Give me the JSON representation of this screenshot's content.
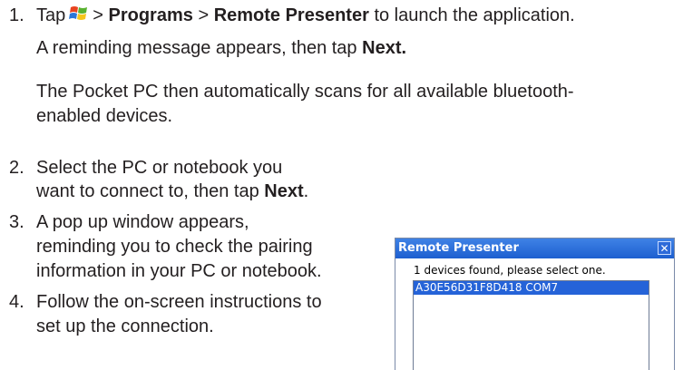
{
  "steps": [
    {
      "number": "1.",
      "line1_a": "Tap",
      "line1_b": ">",
      "line1_programs": "Programs",
      "line1_c": ">",
      "line1_app": "Remote Presenter",
      "line1_d": "to launch the application.",
      "line2_a": "A reminding message appears, then tap",
      "line2_next": "Next.",
      "line3": "The Pocket PC then automatically scans for all available bluetooth-",
      "line4": "enabled devices."
    },
    {
      "number": "2.",
      "line1": "Select the PC or notebook you",
      "line2_a": "want to connect to, then tap",
      "line2_next": "Next",
      "line2_end": "."
    },
    {
      "number": "3.",
      "line1": "A pop up window appears,",
      "line2": "reminding you to check the pairing",
      "line3": "information in your PC or notebook."
    },
    {
      "number": "4.",
      "line1": "Follow the on-screen instructions to",
      "line2": "set up the connection."
    }
  ],
  "dialog": {
    "title": "Remote Presenter",
    "close_glyph": "✕",
    "message": "1 devices found, please select one.",
    "devices": [
      "A30E56D31F8D418 COM7"
    ],
    "accent": "#2563d8"
  },
  "icons": {
    "start": "windows-start-icon"
  }
}
